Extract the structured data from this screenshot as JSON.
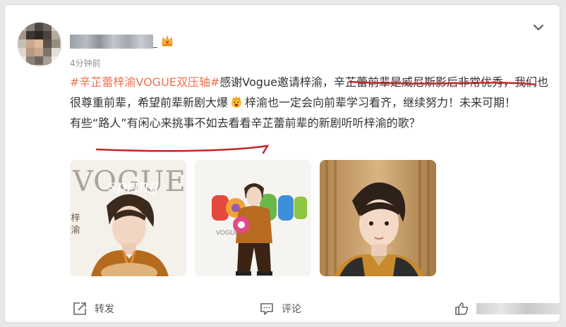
{
  "post": {
    "time": "4分钟前",
    "hashtag": "#辛芷蕾梓渝VOGUE双压轴#",
    "seg1": "感谢Vogue邀请梓渝，",
    "seg2": "辛芷蕾前辈是威尼斯影后非常优秀",
    "seg3": "，我们也很尊重前辈，希望前辈新剧大爆",
    "seg4": "梓渝也一定会向前辈学习看齐，继续努力！未来可期！",
    "seg5a": "有些",
    "seg5b": "“路人”有闲心来挑事不如去看看",
    "seg5c": "辛芷蕾前辈的新剧听听梓渝的歌？"
  },
  "photos": {
    "p1": {
      "logo": "VOGUE",
      "script": "spring",
      "side": "梓 渝"
    },
    "p2": {
      "logo": "VOGUE"
    }
  },
  "actions": {
    "repost": "转发",
    "comment": "评论"
  },
  "colors": {
    "hashtag": "#eb7350",
    "annotation": "#c0282a"
  }
}
